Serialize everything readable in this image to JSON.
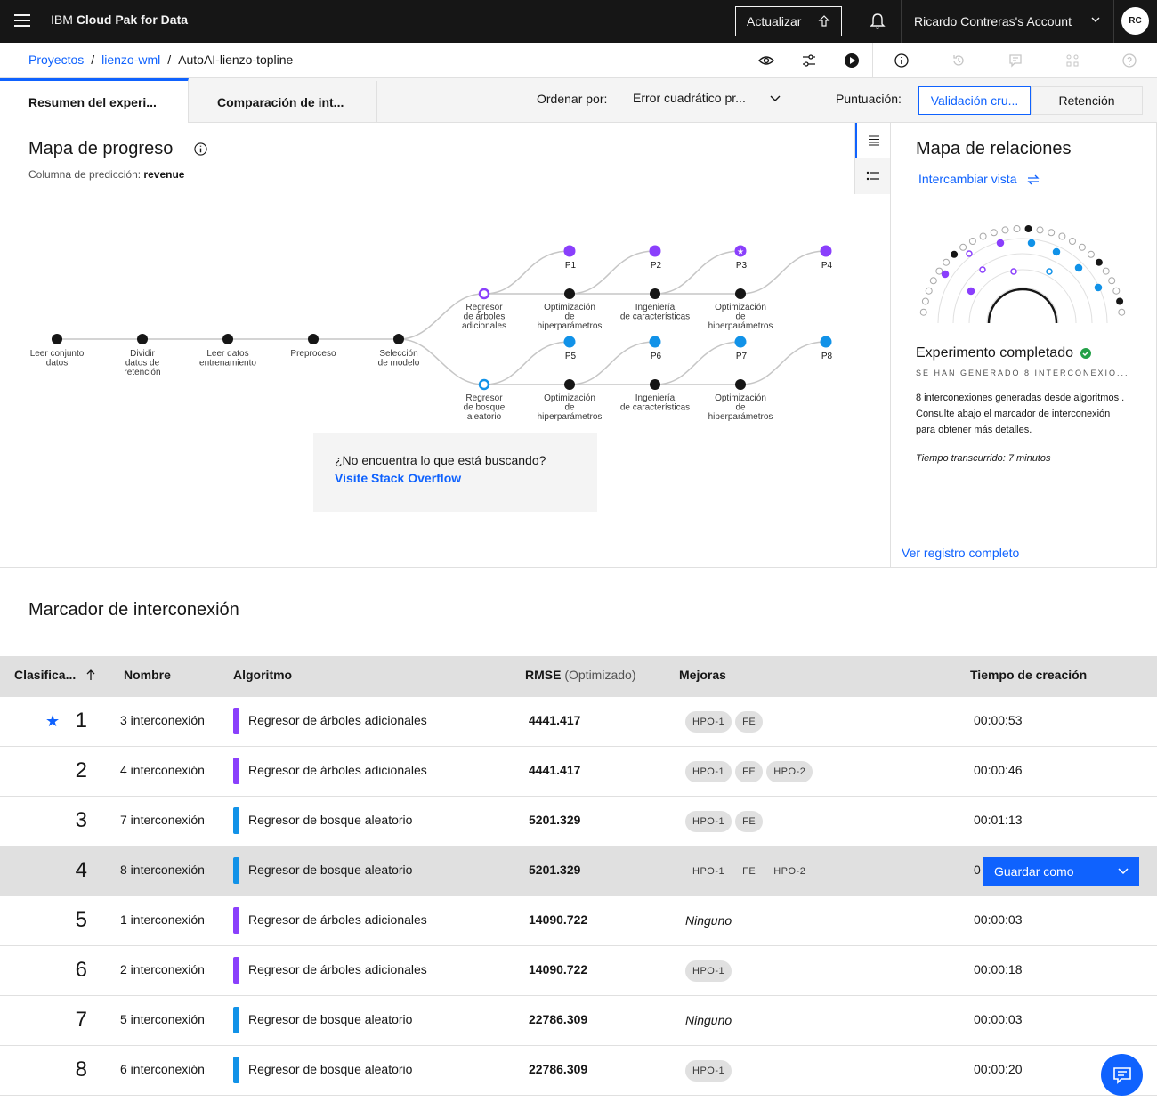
{
  "header": {
    "brand_prefix": "IBM",
    "brand_product": "Cloud Pak for Data",
    "upgrade_label": "Actualizar",
    "account_name": "Ricardo Contreras's Account",
    "avatar_initials": "RC"
  },
  "breadcrumb": {
    "items": [
      "Proyectos",
      "lienzo-wml"
    ],
    "current": "AutoAI-lienzo-topline"
  },
  "tabs": [
    {
      "label": "Resumen del experi..."
    },
    {
      "label": "Comparación de int..."
    }
  ],
  "sort": {
    "label": "Ordenar por:",
    "value": "Error cuadrático pr..."
  },
  "scoring": {
    "label": "Puntuación:",
    "options": [
      "Validación cru...",
      "Retención"
    ],
    "selected": "Validación cru..."
  },
  "progress_map": {
    "title": "Mapa de progreso",
    "prediction_label": "Columna de predicción:",
    "prediction_value": "revenue",
    "main_nodes": [
      [
        "Leer conjunto",
        "datos"
      ],
      [
        "Dividir",
        "datos de",
        "retención"
      ],
      [
        "Leer datos",
        "entrenamiento"
      ],
      [
        "Preproceso"
      ],
      [
        "Selección",
        "de modelo"
      ]
    ],
    "branch_top": {
      "algorithm": [
        "Regresor",
        "de árboles",
        "adicionales"
      ],
      "steps": [
        [
          "Optimización",
          "de",
          "hiperparámetros"
        ],
        [
          "Ingeniería",
          "de características"
        ],
        [
          "Optimización",
          "de",
          "hiperparámetros"
        ]
      ],
      "pipelines": [
        "P1",
        "P2",
        "P3",
        "P4"
      ]
    },
    "branch_bottom": {
      "algorithm": [
        "Regresor",
        "de bosque",
        "aleatorio"
      ],
      "steps": [
        [
          "Optimización",
          "de",
          "hiperparámetros"
        ],
        [
          "Ingeniería",
          "de características"
        ],
        [
          "Optimización",
          "de",
          "hiperparámetros"
        ]
      ],
      "pipelines": [
        "P5",
        "P6",
        "P7",
        "P8"
      ]
    },
    "help_question": "¿No encuentra lo que está buscando?",
    "help_link": "Visite Stack Overflow"
  },
  "relations": {
    "title": "Mapa de relaciones",
    "swap_view": "Intercambiar vista",
    "status": "Experimento completado",
    "generated": "SE HAN GENERADO 8 INTERCONEXIO...",
    "description": "8 interconexiones generadas desde algoritmos . Consulte abajo el marcador de interconexión para obtener más detalles.",
    "elapsed": "Tiempo transcurrido: 7 minutos",
    "full_log": "Ver registro completo"
  },
  "leaderboard": {
    "title": "Marcador de interconexión",
    "columns": {
      "rank": "Clasifica...",
      "name": "Nombre",
      "algorithm": "Algoritmo",
      "rmse": "RMSE",
      "rmse_note": "(Optimizado)",
      "improvements": "Mejoras",
      "created": "Tiempo de creación"
    },
    "save_as": "Guardar como",
    "rows": [
      {
        "rank": "1",
        "name": "3 interconexión",
        "algorithm": "Regresor de árboles adicionales",
        "rmse": "4441.417",
        "tags": [
          "HPO-1",
          "FE"
        ],
        "time": "00:00:53",
        "color": "#8a3ffc",
        "best": true
      },
      {
        "rank": "2",
        "name": "4 interconexión",
        "algorithm": "Regresor de árboles adicionales",
        "rmse": "4441.417",
        "tags": [
          "HPO-1",
          "FE",
          "HPO-2"
        ],
        "time": "00:00:46",
        "color": "#8a3ffc"
      },
      {
        "rank": "3",
        "name": "7 interconexión",
        "algorithm": "Regresor de bosque aleatorio",
        "rmse": "5201.329",
        "tags": [
          "HPO-1",
          "FE"
        ],
        "time": "00:01:13",
        "color": "#1192e8"
      },
      {
        "rank": "4",
        "name": "8 interconexión",
        "algorithm": "Regresor de bosque aleatorio",
        "rmse": "5201.329",
        "tags": [
          "HPO-1",
          "FE",
          "HPO-2"
        ],
        "time": "0",
        "color": "#1192e8",
        "hover": true
      },
      {
        "rank": "5",
        "name": "1 interconexión",
        "algorithm": "Regresor de árboles adicionales",
        "rmse": "14090.722",
        "tags": [],
        "none_label": "Ninguno",
        "time": "00:00:03",
        "color": "#8a3ffc"
      },
      {
        "rank": "6",
        "name": "2 interconexión",
        "algorithm": "Regresor de árboles adicionales",
        "rmse": "14090.722",
        "tags": [
          "HPO-1"
        ],
        "time": "00:00:18",
        "color": "#8a3ffc"
      },
      {
        "rank": "7",
        "name": "5 interconexión",
        "algorithm": "Regresor de bosque aleatorio",
        "rmse": "22786.309",
        "tags": [],
        "none_label": "Ninguno",
        "time": "00:00:03",
        "color": "#1192e8"
      },
      {
        "rank": "8",
        "name": "6 interconexión",
        "algorithm": "Regresor de bosque aleatorio",
        "rmse": "22786.309",
        "tags": [
          "HPO-1"
        ],
        "time": "00:00:20",
        "color": "#1192e8"
      }
    ]
  },
  "colors": {
    "accent": "#0f62fe",
    "extra_trees": "#8a3ffc",
    "random_forest": "#1192e8",
    "success": "#24a148"
  }
}
